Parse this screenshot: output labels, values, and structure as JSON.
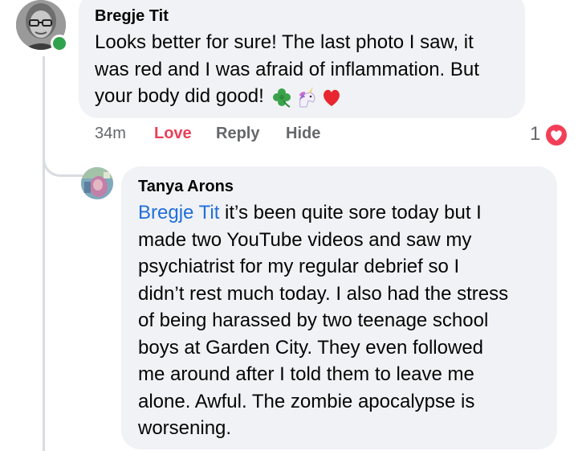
{
  "colors": {
    "bubble_bg": "#f0f2f5",
    "mention": "#216fdb",
    "love_active": "#e9405a",
    "meta_gray": "#65676b",
    "online": "#31a24c",
    "heart": "#f33e58"
  },
  "comments": [
    {
      "author": "Bregje Tit",
      "text_lines": [
        "Looks better for sure! The last photo I saw, it",
        "was red and I was afraid of inflammation. But",
        "your body did good!"
      ],
      "emojis": [
        "four-leaf-clover-icon",
        "unicorn-icon",
        "red-heart-icon"
      ],
      "online": true,
      "timestamp": "34m",
      "actions": {
        "love": "Love",
        "reply": "Reply",
        "hide": "Hide"
      },
      "reaction_count": "1",
      "reaction_icon": "heart-reaction-icon"
    },
    {
      "author": "Tanya Arons",
      "mention": "Bregje Tit",
      "text_lines": [
        " it’s been quite sore today but I",
        "made two YouTube videos and saw my",
        "psychiatrist for my regular debrief so I",
        "didn’t rest much today. I also had the stress",
        "of being harassed by two teenage school",
        "boys at Garden City.  They even followed",
        "me around after I told them to leave me",
        "alone. Awful. The zombie apocalypse is",
        "worsening."
      ]
    }
  ]
}
